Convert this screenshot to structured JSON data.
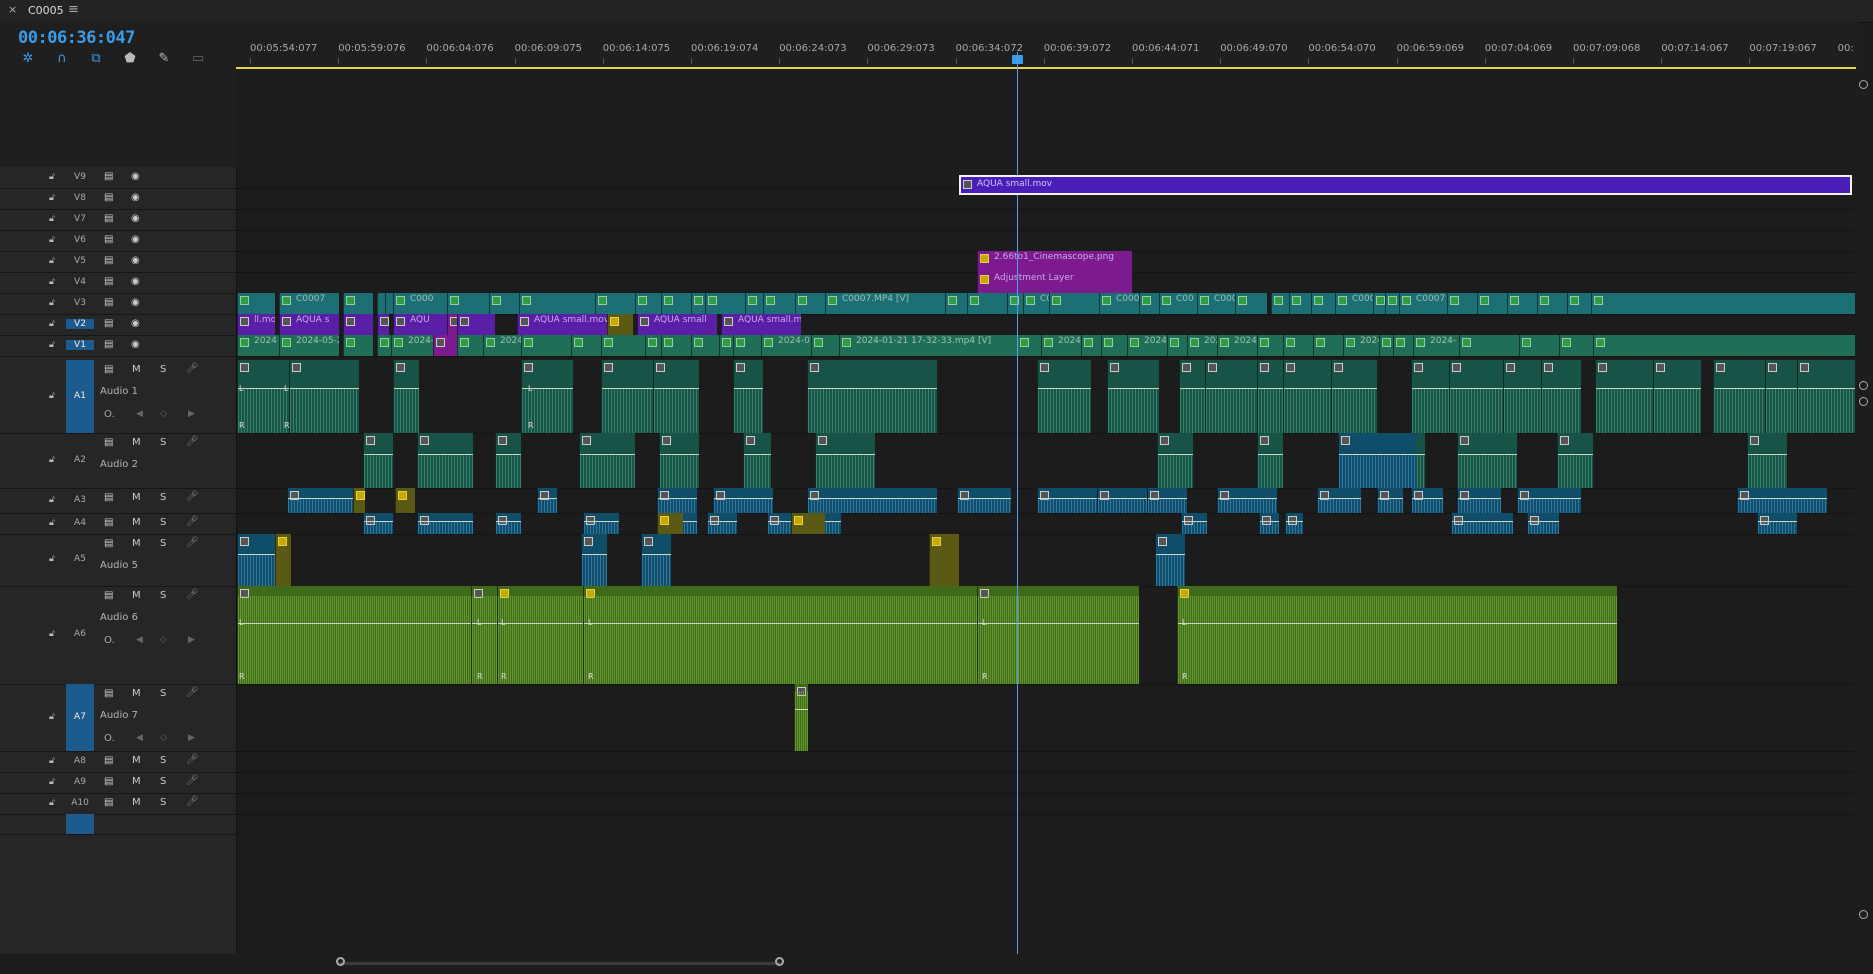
{
  "tab": {
    "close_icon": "close-icon",
    "title": "C0005",
    "menu_icon": "hamburger-icon"
  },
  "timecode": "00:06:36:047",
  "tools": [
    "nest-icon",
    "snap-icon",
    "linked-selection-icon",
    "add-marker-icon",
    "wrench-icon",
    "captions-icon"
  ],
  "ruler": [
    "00:05:54:077",
    "00:05:59:076",
    "00:06:04:076",
    "00:06:09:075",
    "00:06:14:075",
    "00:06:19:074",
    "00:06:24:073",
    "00:06:29:073",
    "00:06:34:072",
    "00:06:39:072",
    "00:06:44:071",
    "00:06:49:070",
    "00:06:54:070",
    "00:06:59:069",
    "00:07:04:069",
    "00:07:09:068",
    "00:07:14:067",
    "00:07:19:067"
  ],
  "ruler_tail": "00:",
  "tracks": {
    "video": [
      "V9",
      "V8",
      "V7",
      "V6",
      "V5",
      "V4",
      "V3",
      "V2",
      "V1"
    ],
    "audio": [
      {
        "id": "A1",
        "name": "Audio 1",
        "volume": "O."
      },
      {
        "id": "A2",
        "name": "Audio 2"
      },
      {
        "id": "A3",
        "name": ""
      },
      {
        "id": "A4",
        "name": ""
      },
      {
        "id": "A5",
        "name": "Audio 5"
      },
      {
        "id": "A6",
        "name": "Audio 6",
        "volume": "O."
      },
      {
        "id": "A7",
        "name": "Audio 7",
        "volume": "O."
      },
      {
        "id": "A8",
        "name": ""
      },
      {
        "id": "A9",
        "name": ""
      },
      {
        "id": "A10",
        "name": ""
      }
    ],
    "mute": "M",
    "solo": "S"
  },
  "clips": {
    "v5": "2.66to1_Cinemascope.png",
    "v4": "Adjustment Layer",
    "v3": [
      "C0007",
      "C000",
      "C0007.MP4 [V]",
      "C00",
      "C0007.MP",
      "C00",
      "C0007",
      "C0007",
      "C0007"
    ],
    "v2": [
      "ll.mov",
      "AQUA s",
      "AQU",
      "AQUA small.mov",
      "AQUA small",
      "AQUA small.m",
      "AQUA small.mov"
    ],
    "v1": [
      "2024",
      "2024-05-2",
      "2024-",
      "2024",
      "2024-0",
      "2024-01-21 17-32-33.mp4 [V]",
      "2024",
      "2024-05-2",
      "202",
      "2024-0",
      "2024-2",
      "2024-"
    ]
  },
  "channel_labels": {
    "left": "L",
    "right": "R"
  },
  "colors": {
    "accent": "#3a9be8",
    "work_area": "#e8d84a",
    "video_clip": "#1f6e57",
    "purple_clip": "#5a1fa6",
    "magenta_clip": "#7d1b8e",
    "green_audio": "#3e6a1a",
    "blue_audio": "#0f4d69"
  }
}
